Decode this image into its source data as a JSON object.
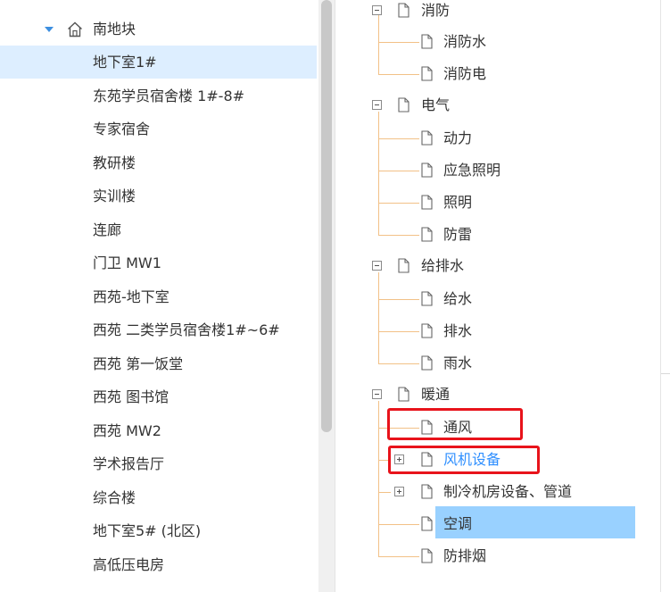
{
  "left_tree": {
    "root": {
      "label": "南地块",
      "icon": "home-icon",
      "expanded": true
    },
    "items": [
      {
        "label": "地下室1#",
        "selected": true
      },
      {
        "label": "东苑学员宿舍楼 1#-8#"
      },
      {
        "label": "专家宿舍"
      },
      {
        "label": "教研楼"
      },
      {
        "label": "实训楼"
      },
      {
        "label": "连廊"
      },
      {
        "label": "门卫 MW1"
      },
      {
        "label": "西苑-地下室"
      },
      {
        "label": "西苑 二类学员宿舍楼1#~6#"
      },
      {
        "label": "西苑 第一饭堂"
      },
      {
        "label": "西苑 图书馆"
      },
      {
        "label": "西苑 MW2"
      },
      {
        "label": "学术报告厅"
      },
      {
        "label": "综合楼"
      },
      {
        "label": "地下室5# (北区)"
      },
      {
        "label": "高低压电房"
      }
    ]
  },
  "right_tree": {
    "groups": [
      {
        "label": "消防",
        "toggle": "collapse",
        "children": [
          {
            "label": "消防水"
          },
          {
            "label": "消防电"
          }
        ]
      },
      {
        "label": "电气",
        "toggle": "collapse",
        "children": [
          {
            "label": "动力"
          },
          {
            "label": "应急照明"
          },
          {
            "label": "照明"
          },
          {
            "label": "防雷"
          }
        ]
      },
      {
        "label": "给排水",
        "toggle": "collapse",
        "children": [
          {
            "label": "给水"
          },
          {
            "label": "排水"
          },
          {
            "label": "雨水"
          }
        ]
      },
      {
        "label": "暖通",
        "toggle": "collapse",
        "children": [
          {
            "label": "通风",
            "annotated": true
          },
          {
            "label": "风机设备",
            "toggle": "expand",
            "annotated": true,
            "link_color": "#2f8fff"
          },
          {
            "label": "制冷机房设备、管道",
            "toggle": "expand"
          },
          {
            "label": "空调",
            "highlighted": true
          },
          {
            "label": "防排烟"
          }
        ]
      }
    ]
  },
  "colors": {
    "selected_bg": "#ddeeff",
    "highlight_bg": "#99d1ff",
    "annotation_red": "#e8131b",
    "tree_line": "#f2c187",
    "expand_caret": "#3d8fe0",
    "link_blue": "#2f8fff"
  }
}
